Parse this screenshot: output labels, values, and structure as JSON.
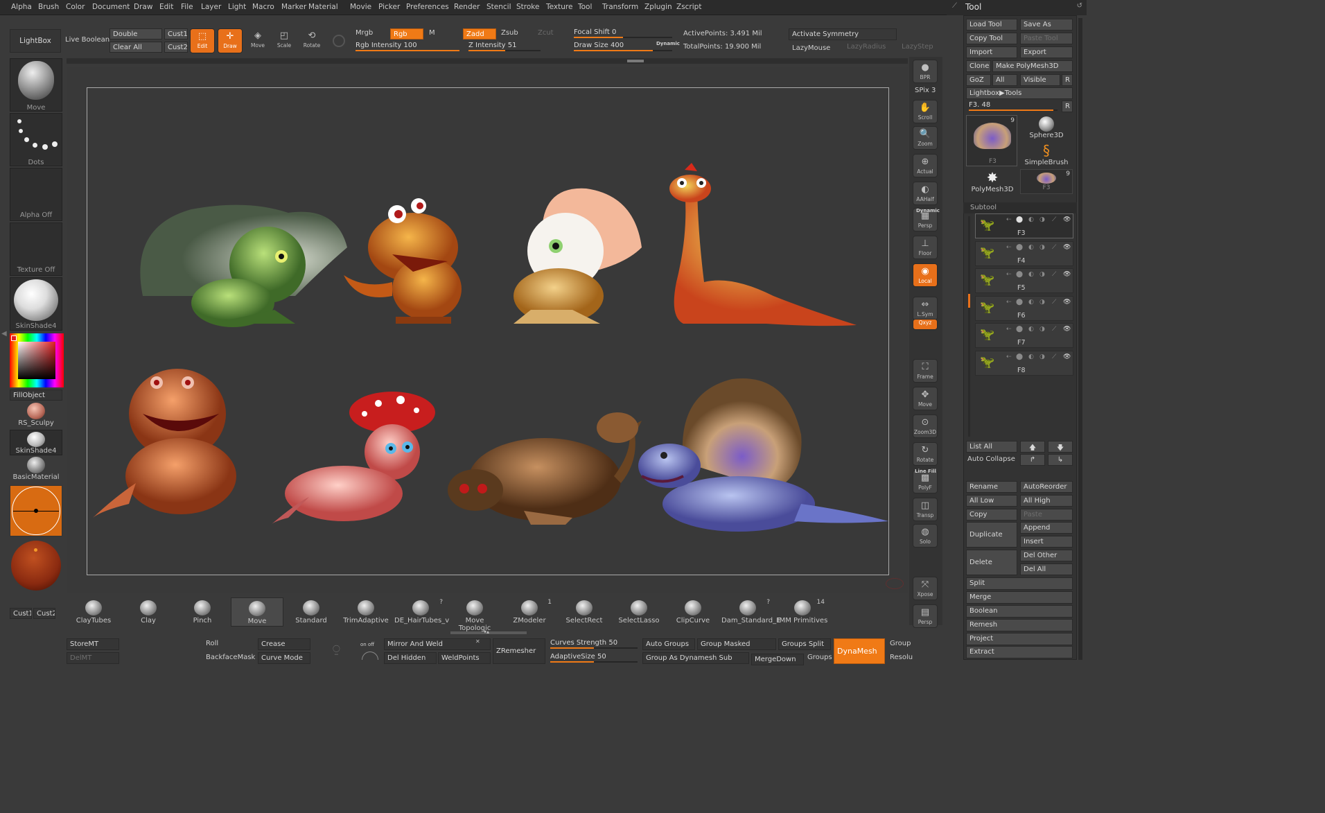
{
  "menu": [
    "Alpha",
    "Brush",
    "Color",
    "Document",
    "Draw",
    "Edit",
    "File",
    "Layer",
    "Light",
    "Macro",
    "Marker",
    "Material",
    "Movie",
    "Picker",
    "Preferences",
    "Render",
    "Stencil",
    "Stroke",
    "Texture",
    "Tool",
    "Transform",
    "Zplugin",
    "Zscript"
  ],
  "top": {
    "lightbox": "LightBox",
    "live_boolean": "Live Boolean",
    "double": "Double",
    "cust1": "Cust1",
    "clear_all": "Clear All",
    "cust2": "Cust2",
    "edit": "Edit",
    "draw": "Draw",
    "move": "Move",
    "scale": "Scale",
    "rotate": "Rotate",
    "mrgb": "Mrgb",
    "rgb": "Rgb",
    "m": "M",
    "zadd": "Zadd",
    "zsub": "Zsub",
    "zcut": "Zcut",
    "rgb_intensity": "Rgb Intensity 100",
    "z_intensity": "Z Intensity 51",
    "focal_shift": "Focal Shift 0",
    "draw_size": "Draw Size 400",
    "dynamic": "Dynamic",
    "active_points": "ActivePoints: 3.491 Mil",
    "total_points": "TotalPoints: 19.900 Mil",
    "activate_symmetry": "Activate Symmetry",
    "lazymouse": "LazyMouse",
    "lazyradius": "LazyRadius",
    "lazystep": "LazyStep"
  },
  "slider_levels": {
    "rgb_intensity": 1.0,
    "z_intensity": 0.51,
    "focal_shift": 0.5,
    "draw_size": 0.8
  },
  "left_tray": {
    "move": "Move",
    "dots": "Dots",
    "alpha_off": "Alpha Off",
    "texture_off": "Texture Off",
    "skinshade4": "SkinShade4",
    "fillobject": "FillObject",
    "rs_sculpy": "RS_Sculpy",
    "skinshade4_b": "SkinShade4",
    "basicmaterial": "BasicMaterial",
    "cust1": "Cust1",
    "cust2": "Cust2"
  },
  "right_shelf": [
    {
      "label": "BPR",
      "icon": "bpr-icon"
    },
    {
      "label": "SPix 3",
      "icon": ""
    },
    {
      "label": "Scroll",
      "icon": "hand-icon"
    },
    {
      "label": "Zoom",
      "icon": "zoom-icon"
    },
    {
      "label": "Actual",
      "icon": "actual-icon"
    },
    {
      "label": "AAHalf",
      "icon": "aahalf-icon"
    },
    {
      "label": "Persp",
      "icon": "persp-icon"
    },
    {
      "label": "Floor",
      "icon": "floor-icon"
    },
    {
      "label": "Local",
      "icon": "local-icon"
    },
    {
      "label": "L.Sym",
      "icon": "lsym-icon"
    },
    {
      "label": "Qxyz",
      "icon": "xyz-icon"
    },
    {
      "label": "Frame",
      "icon": "frame-icon"
    },
    {
      "label": "Move",
      "icon": "move-icon"
    },
    {
      "label": "Zoom3D",
      "icon": "zoom3d-icon"
    },
    {
      "label": "Rotate",
      "icon": "rotate-icon"
    },
    {
      "label": "PolyF",
      "icon": "polyf-icon"
    },
    {
      "label": "Transp",
      "icon": "transp-icon"
    },
    {
      "label": "Solo",
      "icon": "solo-icon"
    },
    {
      "label": "Xpose",
      "icon": "xpose-icon"
    },
    {
      "label": "Persp",
      "icon": "persp2-icon"
    }
  ],
  "shelf_extra": {
    "dynamic": "Dynamic",
    "line_fill": "Line Fill"
  },
  "tool_panel": {
    "title": "Tool",
    "load_tool": "Load Tool",
    "save_as": "Save As",
    "copy_tool": "Copy Tool",
    "paste_tool": "Paste Tool",
    "import": "Import",
    "export": "Export",
    "clone": "Clone",
    "make_polymesh": "Make PolyMesh3D",
    "goz": "GoZ",
    "all": "All",
    "visible": "Visible",
    "r": "R",
    "lightbox_tools": "Lightbox▶Tools",
    "f3_value": "F3. 48",
    "thumbs": [
      {
        "label": "F3",
        "count": "9"
      },
      {
        "label": "Sphere3D",
        "count": ""
      },
      {
        "label": "SimpleBrush",
        "count": ""
      },
      {
        "label": "PolyMesh3D",
        "count": ""
      },
      {
        "label": "F3",
        "count": "9"
      }
    ],
    "subtool_title": "Subtool",
    "subtools": [
      "F3",
      "F4",
      "F5",
      "F6",
      "F7",
      "F8"
    ],
    "list_all": "List All",
    "auto_collapse": "Auto Collapse",
    "rename": "Rename",
    "autoreorder": "AutoReorder",
    "all_low": "All Low",
    "all_high": "All High",
    "copy": "Copy",
    "paste": "Paste",
    "duplicate": "Duplicate",
    "append": "Append",
    "insert": "Insert",
    "delete": "Delete",
    "del_other": "Del Other",
    "del_all": "Del All",
    "split": "Split",
    "merge": "Merge",
    "boolean": "Boolean",
    "remesh": "Remesh",
    "project": "Project",
    "extract": "Extract"
  },
  "brushes": [
    {
      "label": "ClayTubes",
      "count": ""
    },
    {
      "label": "Clay",
      "count": ""
    },
    {
      "label": "Pinch",
      "count": ""
    },
    {
      "label": "Move",
      "count": ""
    },
    {
      "label": "Standard",
      "count": ""
    },
    {
      "label": "TrimAdaptive",
      "count": ""
    },
    {
      "label": "DE_HairTubes_v",
      "count": "?"
    },
    {
      "label": "Move Topologic",
      "count": ""
    },
    {
      "label": "ZModeler",
      "count": "1"
    },
    {
      "label": "SelectRect",
      "count": ""
    },
    {
      "label": "SelectLasso",
      "count": ""
    },
    {
      "label": "ClipCurve",
      "count": ""
    },
    {
      "label": "Dam_Standard_E",
      "count": "?"
    },
    {
      "label": "IMM Primitives",
      "count": "14"
    }
  ],
  "bottom": {
    "storemt": "StoreMT",
    "delmt": "DelMT",
    "roll": "Roll",
    "crease": "Crease",
    "backfacemask": "BackfaceMask",
    "curve_mode": "Curve Mode",
    "onoff": "on  off",
    "mirror_weld": "Mirror And Weld",
    "del_hidden": "Del Hidden",
    "weldpoints": "WeldPoints",
    "zremesher": "ZRemesher",
    "curves_strength": "Curves Strength 50",
    "adaptive_size": "AdaptiveSize 50",
    "auto_groups": "Auto Groups",
    "group_masked": "Group Masked",
    "groups_split": "Groups Split",
    "group_as_dynamesh": "Group As Dynamesh Sub",
    "mergedown": "MergeDown",
    "groups": "Groups",
    "dynamesh": "DynaMesh",
    "group": "Group",
    "resolu": "Resolu"
  },
  "colors": {
    "accent": "#f07a16",
    "bg": "#3a3a3a",
    "canvas": "#393939"
  }
}
